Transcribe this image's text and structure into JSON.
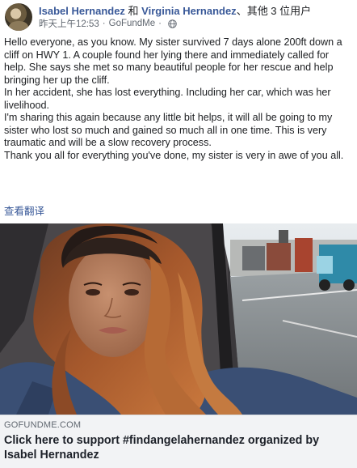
{
  "post": {
    "author": "Isabel Hernandez",
    "with_joiner": " 和 ",
    "tagged_user": "Virginia Hernandez",
    "others_text": "、其他 3 位用户",
    "timestamp": "昨天上午12:53",
    "dot": "·",
    "app": "GoFundMe",
    "privacy_icon": "globe-icon",
    "body": [
      "Hello everyone, as you know. My sister survived 7 days alone 200ft down a cliff on HWY 1. A couple found her lying there and immediately called for help. She says she met so many beautiful people for her rescue and help bringing her up the cliff.",
      "In her accident, she has lost everything. Including her car, which was her livelihood.",
      "I'm sharing this again because any little bit helps, it will all be going to my sister who lost so much and gained so much all in one time. This is very traumatic and will be a slow recovery process.",
      "Thank you all for everything you've done, my sister is very in awe of you all."
    ],
    "see_translation": "查看翻译"
  },
  "link_preview": {
    "domain": "GOFUNDME.COM",
    "title": "Click here to support #findangelahernandez organized by Isabel Hernandez"
  },
  "colors": {
    "link_blue": "#385898",
    "meta_gray": "#606770",
    "preview_bg": "#f2f3f5"
  }
}
